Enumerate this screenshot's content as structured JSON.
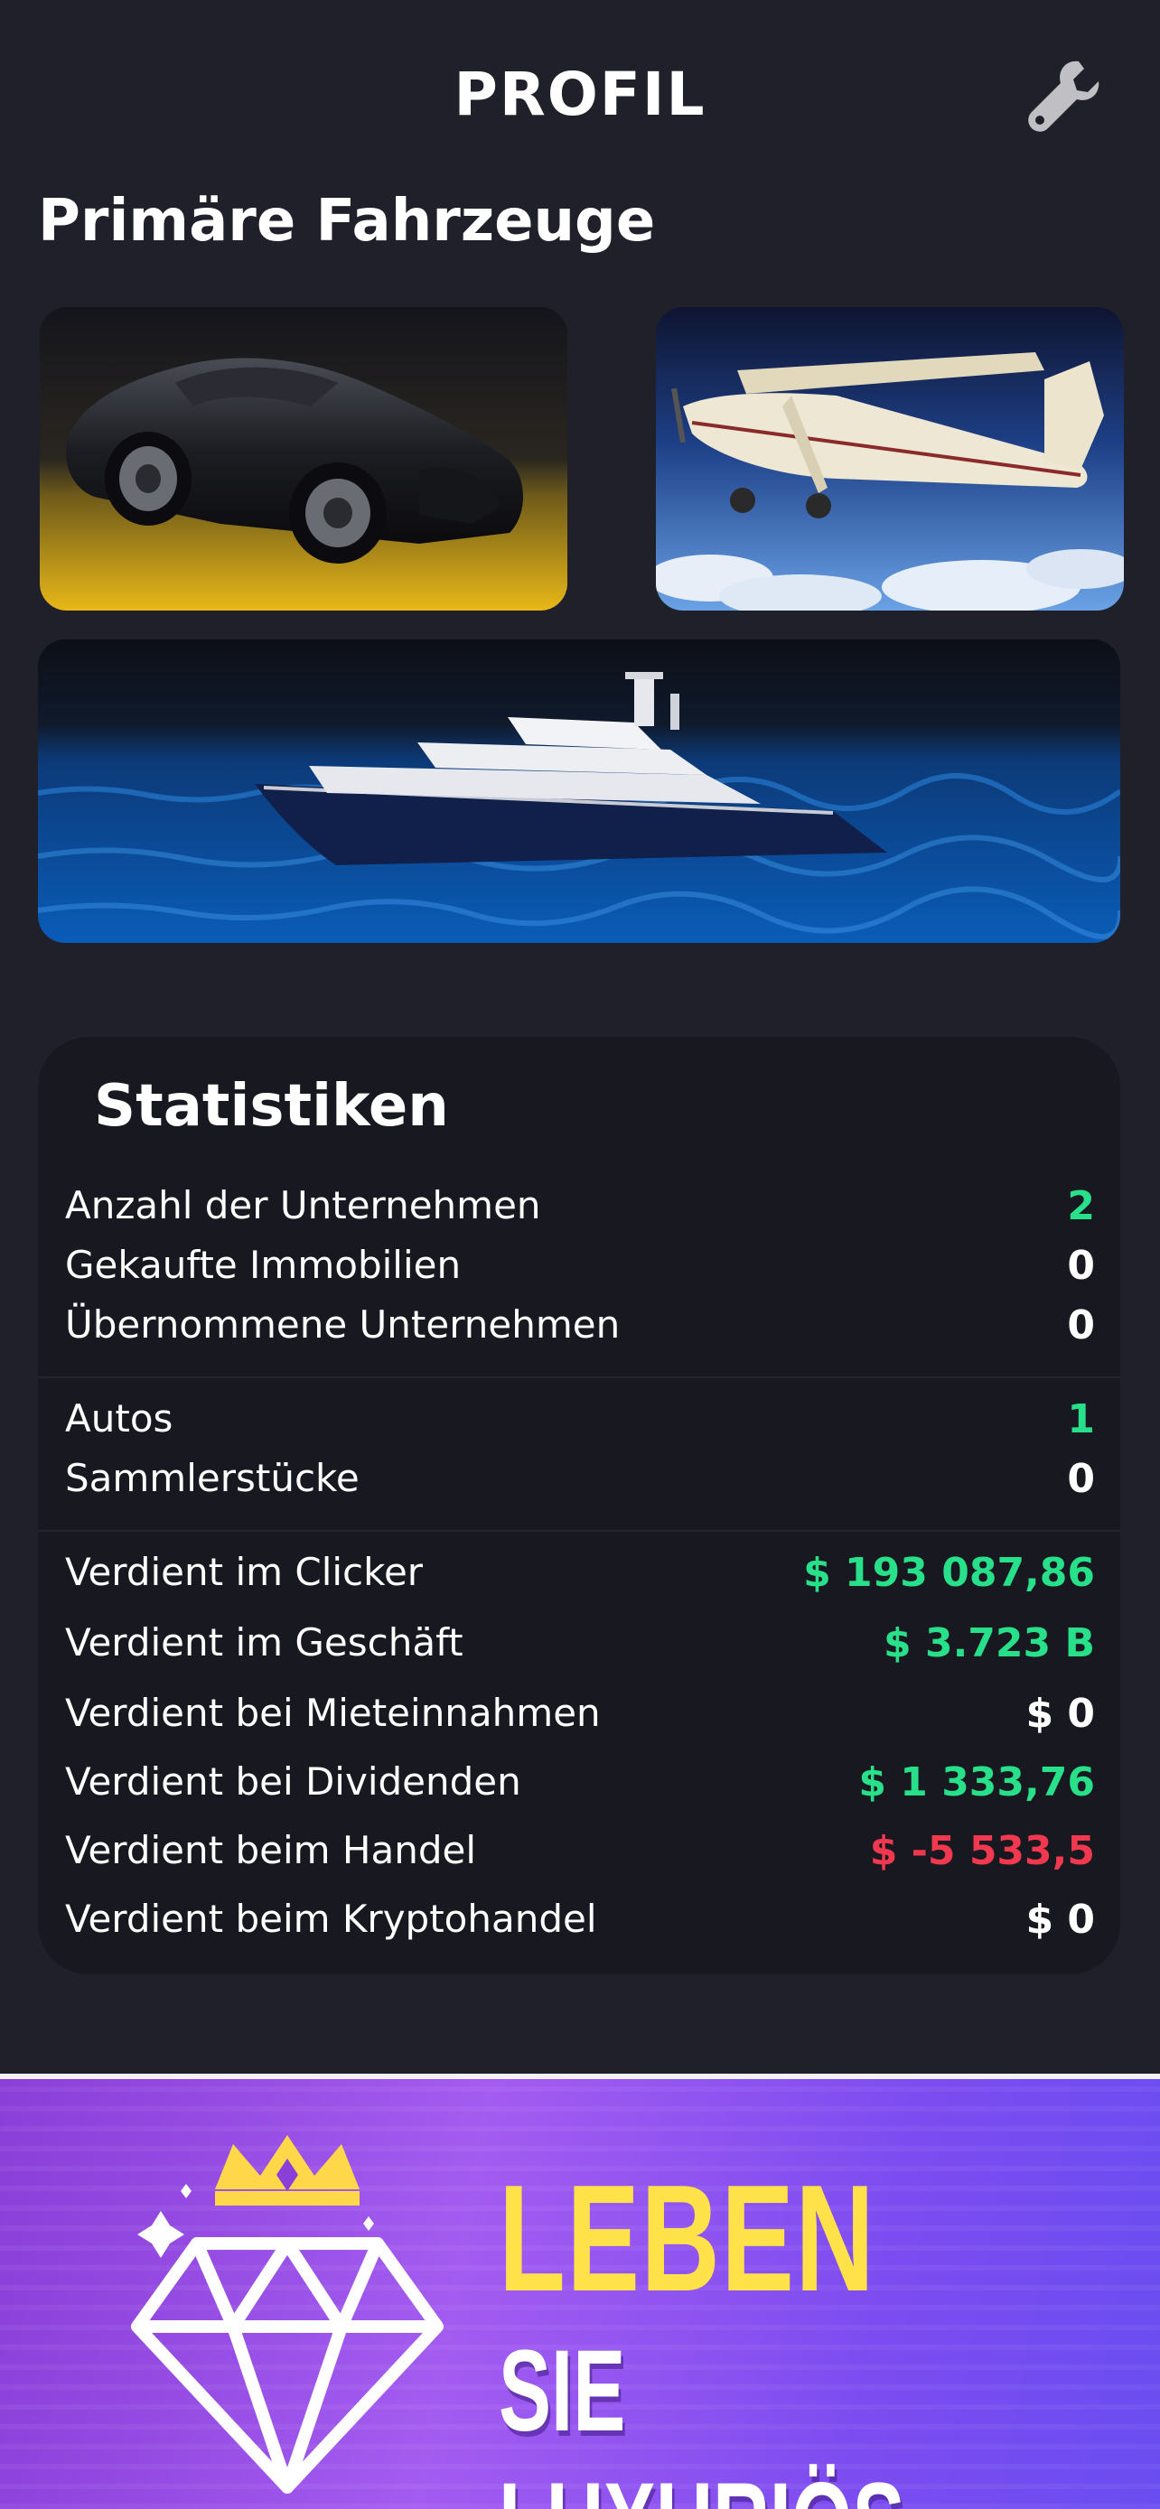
{
  "header": {
    "title": "PROFIL",
    "settings_icon": "wrench-icon"
  },
  "vehicles": {
    "section_title": "Primäre Fahrzeuge",
    "items": [
      {
        "type": "car"
      },
      {
        "type": "plane"
      },
      {
        "type": "yacht"
      }
    ]
  },
  "stats": {
    "title": "Statistiken",
    "groups": [
      [
        {
          "label": "Anzahl der Unternehmen",
          "value": "2",
          "color": "#28e08a"
        },
        {
          "label": "Gekaufte Immobilien",
          "value": "0",
          "color": "#ffffff"
        },
        {
          "label": "Übernommene Unternehmen",
          "value": "0",
          "color": "#ffffff"
        }
      ],
      [
        {
          "label": "Autos",
          "value": "1",
          "color": "#28e08a"
        },
        {
          "label": "Sammlerstücke",
          "value": "0",
          "color": "#ffffff"
        }
      ],
      [
        {
          "label": "Verdient im Clicker",
          "value": "$ 193 087,86",
          "color": "#28e08a"
        },
        {
          "label": "Verdient im Geschäft",
          "value": "$ 3.723 B",
          "color": "#28e08a"
        },
        {
          "label": "Verdient bei Mieteinnahmen",
          "value": "$ 0",
          "color": "#ffffff"
        },
        {
          "label": "Verdient bei Dividenden",
          "value": "$ 1 333,76",
          "color": "#28e08a"
        },
        {
          "label": "Verdient beim Handel",
          "value": "$ -5 533,5",
          "color": "#f0394e"
        },
        {
          "label": "Verdient beim Kryptohandel",
          "value": "$ 0",
          "color": "#ffffff"
        }
      ]
    ]
  },
  "banner": {
    "line1": "LEBEN",
    "line2": "SIE LUXURIÖS",
    "icon": "diamond-crown-icon"
  }
}
